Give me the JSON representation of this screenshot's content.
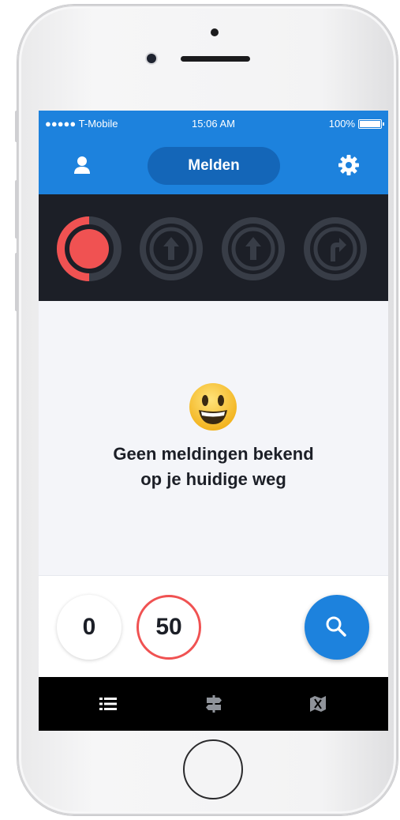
{
  "status_bar": {
    "carrier": "●●●●● T-Mobile",
    "time": "15:06 AM",
    "battery": "100%"
  },
  "nav": {
    "title": "Melden",
    "left_icon": "user-icon",
    "right_icon": "gear-icon"
  },
  "signals": [
    {
      "icon": "traffic-light-red-icon",
      "state": "active-red",
      "progress": 0.5
    },
    {
      "icon": "arrow-up-icon",
      "state": "inactive"
    },
    {
      "icon": "arrow-up-icon",
      "state": "inactive"
    },
    {
      "icon": "arrow-turn-right-icon",
      "state": "inactive"
    }
  ],
  "empty_state": {
    "emoji": "smiley-icon",
    "line1": "Geen meldingen bekend",
    "line2": "op je huidige weg"
  },
  "speed": {
    "current": "0",
    "limit": "50"
  },
  "tabs": [
    {
      "icon": "list-icon"
    },
    {
      "icon": "signpost-icon"
    },
    {
      "icon": "map-icon"
    }
  ],
  "colors": {
    "primary": "#1d82dd",
    "dark": "#1c1f27",
    "alert_red": "#f05252"
  }
}
